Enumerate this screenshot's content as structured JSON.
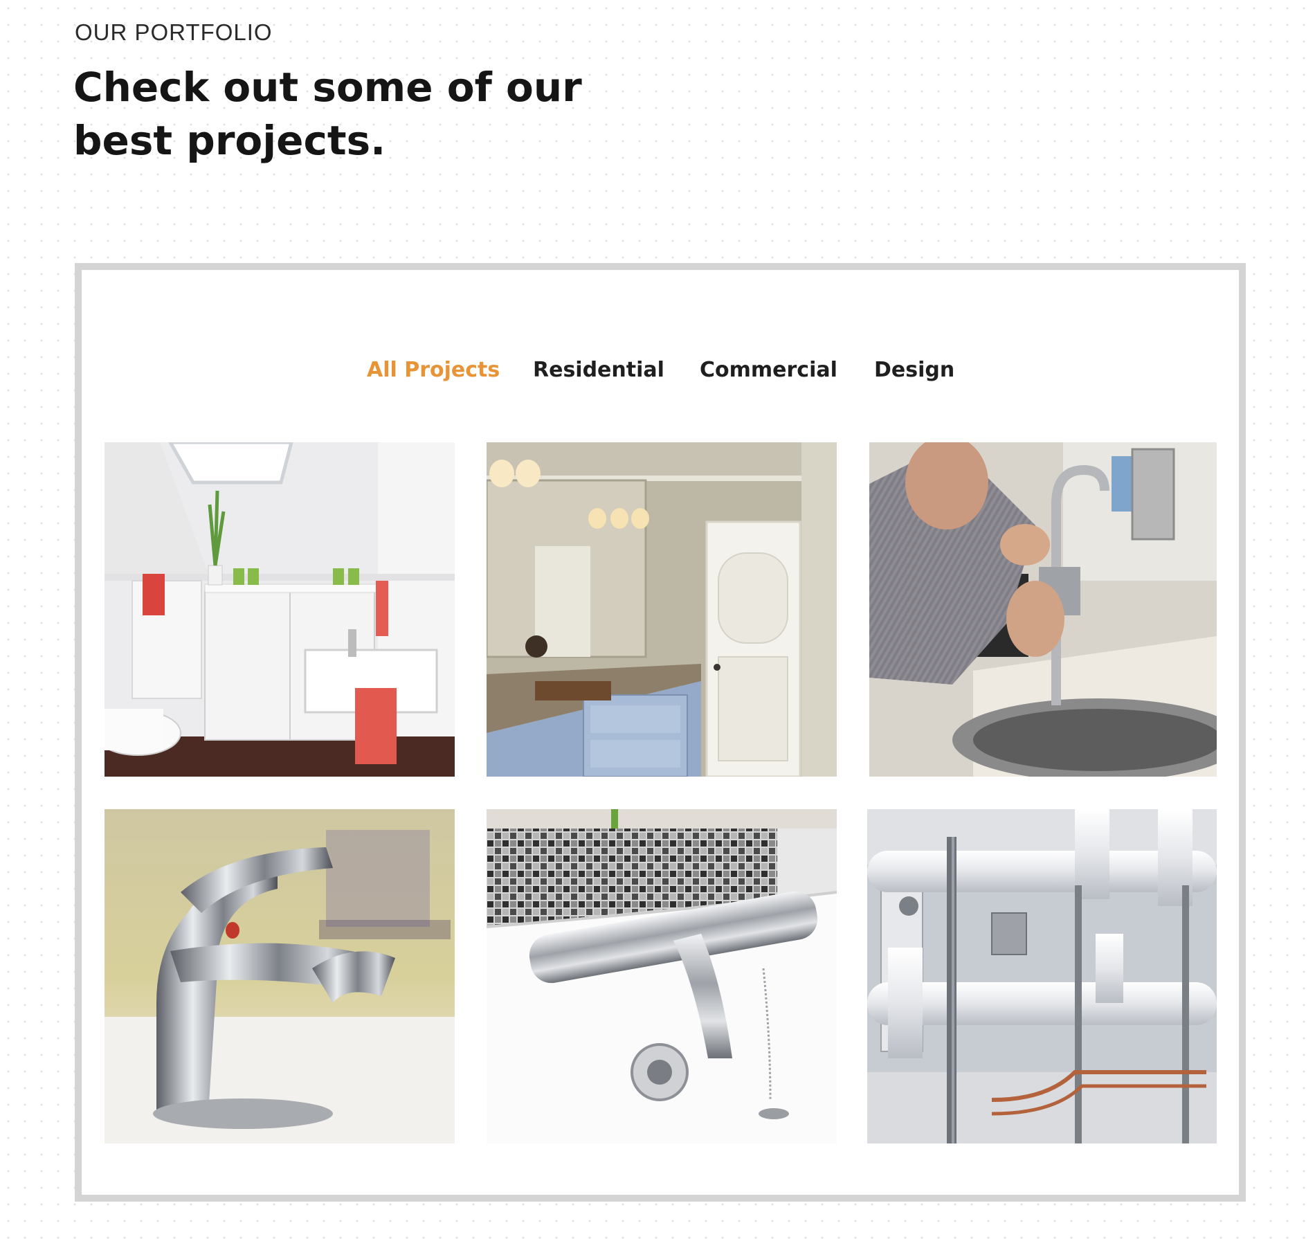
{
  "section": {
    "eyebrow": "OUR PORTFOLIO",
    "headline": "Check out some of our best projects."
  },
  "filters": [
    {
      "label": "All Projects",
      "active": true
    },
    {
      "label": "Residential",
      "active": false
    },
    {
      "label": "Commercial",
      "active": false
    },
    {
      "label": "Design",
      "active": false
    }
  ],
  "colors": {
    "accent": "#e89336",
    "heading": "#151515",
    "frame_border": "#d4d4d4"
  }
}
